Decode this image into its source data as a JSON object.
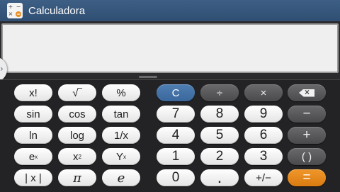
{
  "app": {
    "title": "Calculadora"
  },
  "icon": {
    "q1": "+",
    "q2": "−",
    "q3": "×",
    "q4": "="
  },
  "display": {
    "value": ""
  },
  "side_tab": {
    "glyph": "›"
  },
  "keys": {
    "fact": "x!",
    "sqrt": "√‾",
    "percent": "%",
    "sin": "sin",
    "cos": "cos",
    "tan": "tan",
    "ln": "ln",
    "log": "log",
    "inv": "1/x",
    "exp_base": "e",
    "exp_sup": "x",
    "sq_base": "x",
    "sq_sup": "2",
    "pow_base": "Y",
    "pow_sup": "x",
    "abs": "| x |",
    "pi": "π",
    "e": "e",
    "clear": "C",
    "divide": "÷",
    "multiply": "×",
    "minus": "−",
    "plus": "+",
    "parens": "( )",
    "equals": "=",
    "n7": "7",
    "n8": "8",
    "n9": "9",
    "n4": "4",
    "n5": "5",
    "n6": "6",
    "n1": "1",
    "n2": "2",
    "n3": "3",
    "n0": "0",
    "dot": ".",
    "sign": "+/−"
  },
  "colors": {
    "titlebar": "#3e5f85",
    "clear": "#4f7fb4",
    "equals": "#f1962a",
    "keypad_bg": "#232325"
  }
}
